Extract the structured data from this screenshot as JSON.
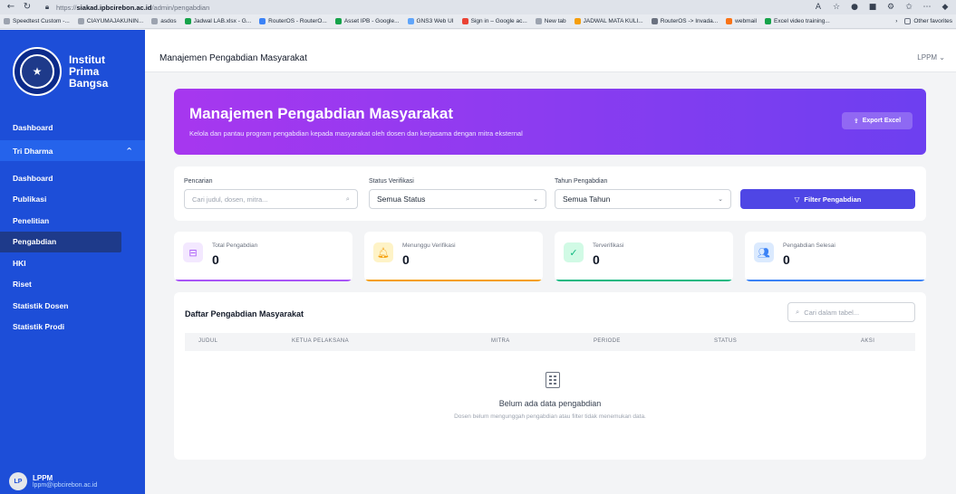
{
  "browser": {
    "url_prefix": "https://",
    "url_host": "siakad.ipbcirebon.ac.id",
    "url_path": "/admin/pengabdian",
    "bookmarks": [
      {
        "label": "Speedtest Custom -...",
        "color": "#9ca3af"
      },
      {
        "label": "CIAYUMAJAKUNIN...",
        "color": "#9ca3af"
      },
      {
        "label": "asdos",
        "color": "#9ca3af"
      },
      {
        "label": "Jadwal LAB.xlsx - G...",
        "color": "#16a34a"
      },
      {
        "label": "RouterOS - RouterO...",
        "color": "#3b82f6"
      },
      {
        "label": "Asset IPB - Google...",
        "color": "#16a34a"
      },
      {
        "label": "GNS3 Web UI",
        "color": "#60a5fa"
      },
      {
        "label": "Sign in – Google ac...",
        "color": "#ea4335"
      },
      {
        "label": "New tab",
        "color": "#9ca3af"
      },
      {
        "label": "JADWAL MATA KULI...",
        "color": "#f59e0b"
      },
      {
        "label": "RouterOS -> Invada...",
        "color": "#6b7280"
      },
      {
        "label": "webmail",
        "color": "#f97316"
      },
      {
        "label": "Excel video training...",
        "color": "#16a34a"
      }
    ],
    "other_favorites": "Other favorites"
  },
  "sidebar": {
    "brand_line1": "Institut",
    "brand_line2": "Prima",
    "brand_line3": "Bangsa",
    "dashboard": "Dashboard",
    "tri_dharma": "Tri Dharma",
    "items": [
      "Dashboard",
      "Publikasi",
      "Penelitian",
      "Pengabdian",
      "HKI",
      "Riset",
      "Statistik Dosen",
      "Statistik Prodi"
    ],
    "user_initials": "LP",
    "user_name": "LPPM",
    "user_email": "lppm@ipbcirebon.ac.id"
  },
  "header": {
    "title": "Manajemen Pengabdian Masyarakat",
    "user": "LPPM ⌄"
  },
  "banner": {
    "title": "Manajemen Pengabdian Masyarakat",
    "subtitle": "Kelola dan pantau program pengabdian kepada masyarakat oleh dosen dan kerjasama dengan mitra eksternal",
    "export_label": "Export Excel"
  },
  "filters": {
    "search_label": "Pencarian",
    "search_placeholder": "Cari judul, dosen, mitra...",
    "status_label": "Status Verifikasi",
    "status_value": "Semua Status",
    "year_label": "Tahun Pengabdian",
    "year_value": "Semua Tahun",
    "filter_button": "Filter Pengabdian"
  },
  "stats": [
    {
      "label": "Total Pengabdian",
      "value": "0",
      "color": "#a855f7",
      "bg": "#f3e8ff"
    },
    {
      "label": "Menunggu Verifikasi",
      "value": "0",
      "color": "#f59e0b",
      "bg": "#fef3c7"
    },
    {
      "label": "Terverifikasi",
      "value": "0",
      "color": "#10b981",
      "bg": "#d1fae5"
    },
    {
      "label": "Pengabdian Selesai",
      "value": "0",
      "color": "#3b82f6",
      "bg": "#dbeafe"
    }
  ],
  "table": {
    "title": "Daftar Pengabdian Masyarakat",
    "search_placeholder": "Cari dalam tabel...",
    "columns": [
      "JUDUL",
      "KETUA PELAKSANA",
      "MITRA",
      "PERIODE",
      "STATUS",
      "AKSI"
    ],
    "empty_title": "Belum ada data pengabdian",
    "empty_subtitle": "Dosen belum mengunggah pengabdian atau filter tidak menemukan data."
  }
}
